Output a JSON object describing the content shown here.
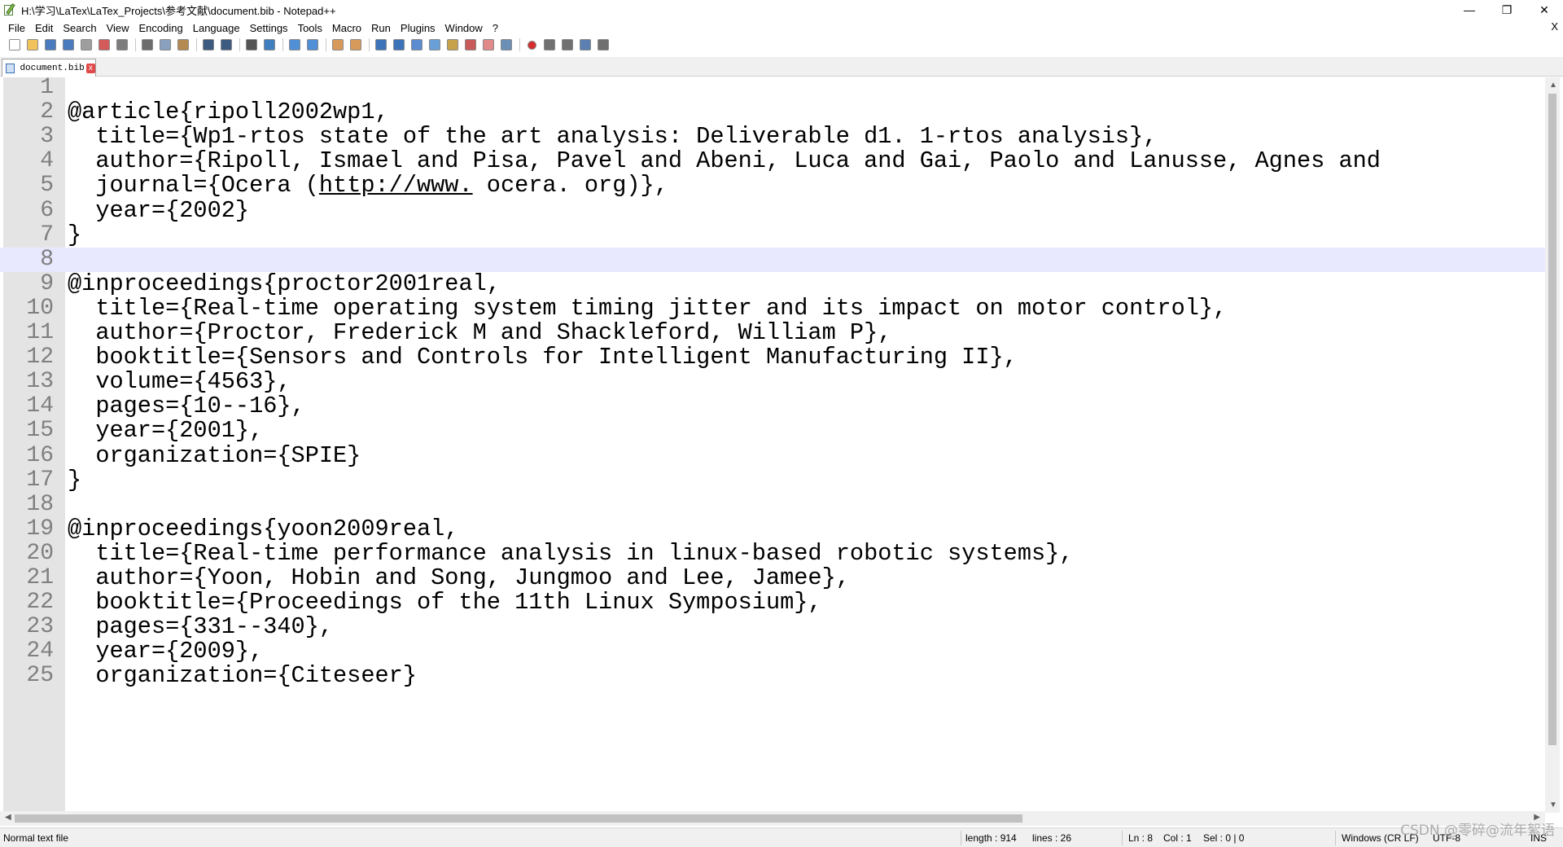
{
  "window": {
    "title": "H:\\学习\\LaTex\\LaTex_Projects\\参考文献\\document.bib - Notepad++",
    "minimize_glyph": "—",
    "maximize_glyph": "❐",
    "close_glyph": "✕"
  },
  "menu": {
    "items": [
      "File",
      "Edit",
      "Search",
      "View",
      "Encoding",
      "Language",
      "Settings",
      "Tools",
      "Macro",
      "Run",
      "Plugins",
      "Window",
      "?"
    ],
    "close_label": "X"
  },
  "toolbar": {
    "icons": [
      {
        "name": "new-file-icon",
        "color": "#ffffff"
      },
      {
        "name": "open-file-icon",
        "color": "#f2c35a"
      },
      {
        "name": "save-icon",
        "color": "#4a7bbf"
      },
      {
        "name": "save-all-icon",
        "color": "#4a7bbf"
      },
      {
        "name": "close-icon",
        "color": "#9e9e9e"
      },
      {
        "name": "close-all-icon",
        "color": "#d35b5b"
      },
      {
        "name": "print-icon",
        "color": "#7d7d7d"
      },
      {
        "name": "cut-icon",
        "color": "#6d6d6d"
      },
      {
        "name": "copy-icon",
        "color": "#8aa0bf"
      },
      {
        "name": "paste-icon",
        "color": "#b58a52"
      },
      {
        "name": "undo-icon",
        "color": "#3d5a80"
      },
      {
        "name": "redo-icon",
        "color": "#3d5a80"
      },
      {
        "name": "find-icon",
        "color": "#555555"
      },
      {
        "name": "replace-icon",
        "color": "#3f7fbf"
      },
      {
        "name": "zoom-in-icon",
        "color": "#4f8fd6"
      },
      {
        "name": "zoom-out-icon",
        "color": "#4f8fd6"
      },
      {
        "name": "sync-vertical-icon",
        "color": "#d89a5a"
      },
      {
        "name": "sync-horizontal-icon",
        "color": "#d89a5a"
      },
      {
        "name": "word-wrap-icon",
        "color": "#3d73b8"
      },
      {
        "name": "show-all-chars-icon",
        "color": "#3d73b8"
      },
      {
        "name": "indent-guide-icon",
        "color": "#5b8bd0"
      },
      {
        "name": "language-icon",
        "color": "#6aa0d8"
      },
      {
        "name": "doc-map-icon",
        "color": "#c7a24a"
      },
      {
        "name": "function-list-icon",
        "color": "#c85a5a"
      },
      {
        "name": "folder-workspace-icon",
        "color": "#e08a8a"
      },
      {
        "name": "monitoring-icon",
        "color": "#6b8fb5"
      },
      {
        "name": "record-macro-icon",
        "color": "#d62c2c"
      },
      {
        "name": "stop-macro-icon",
        "color": "#707070"
      },
      {
        "name": "play-macro-icon",
        "color": "#707070"
      },
      {
        "name": "run-macro-multiple-icon",
        "color": "#5a7fb0"
      },
      {
        "name": "save-macro-icon",
        "color": "#707070"
      }
    ]
  },
  "tab": {
    "label": "document.bib",
    "close_glyph": "x"
  },
  "editor": {
    "current_line": 8,
    "lines": [
      {
        "n": "1",
        "text": ""
      },
      {
        "n": "2",
        "text": "@article{ripoll2002wp1,"
      },
      {
        "n": "3",
        "text": "  title={Wp1-rtos state of the art analysis: Deliverable d1. 1-rtos analysis},"
      },
      {
        "n": "4",
        "text": "  author={Ripoll, Ismael and Pisa, Pavel and Abeni, Luca and Gai, Paolo and Lanusse, Agnes and"
      },
      {
        "n": "5",
        "pre": "  journal={Ocera (",
        "link": "http://www.",
        "post": " ocera. org)},"
      },
      {
        "n": "6",
        "text": "  year={2002}"
      },
      {
        "n": "7",
        "text": "}"
      },
      {
        "n": "8",
        "text": ""
      },
      {
        "n": "9",
        "text": "@inproceedings{proctor2001real,"
      },
      {
        "n": "10",
        "text": "  title={Real-time operating system timing jitter and its impact on motor control},"
      },
      {
        "n": "11",
        "text": "  author={Proctor, Frederick M and Shackleford, William P},"
      },
      {
        "n": "12",
        "text": "  booktitle={Sensors and Controls for Intelligent Manufacturing II},"
      },
      {
        "n": "13",
        "text": "  volume={4563},"
      },
      {
        "n": "14",
        "text": "  pages={10--16},"
      },
      {
        "n": "15",
        "text": "  year={2001},"
      },
      {
        "n": "16",
        "text": "  organization={SPIE}"
      },
      {
        "n": "17",
        "text": "}"
      },
      {
        "n": "18",
        "text": ""
      },
      {
        "n": "19",
        "text": "@inproceedings{yoon2009real,"
      },
      {
        "n": "20",
        "text": "  title={Real-time performance analysis in linux-based robotic systems},"
      },
      {
        "n": "21",
        "text": "  author={Yoon, Hobin and Song, Jungmoo and Lee, Jamee},"
      },
      {
        "n": "22",
        "text": "  booktitle={Proceedings of the 11th Linux Symposium},"
      },
      {
        "n": "23",
        "text": "  pages={331--340},"
      },
      {
        "n": "24",
        "text": "  year={2009},"
      },
      {
        "n": "25",
        "text": "  organization={Citeseer}"
      }
    ]
  },
  "status": {
    "file_type": "Normal text file",
    "length": "length : 914",
    "lines": "lines : 26",
    "ln": "Ln : 8",
    "col": "Col : 1",
    "sel": "Sel : 0 | 0",
    "eol": "Windows (CR LF)",
    "encoding": "UTF-8",
    "mode": "INS",
    "watermark": "CSDN @零碎@流年絮语"
  }
}
